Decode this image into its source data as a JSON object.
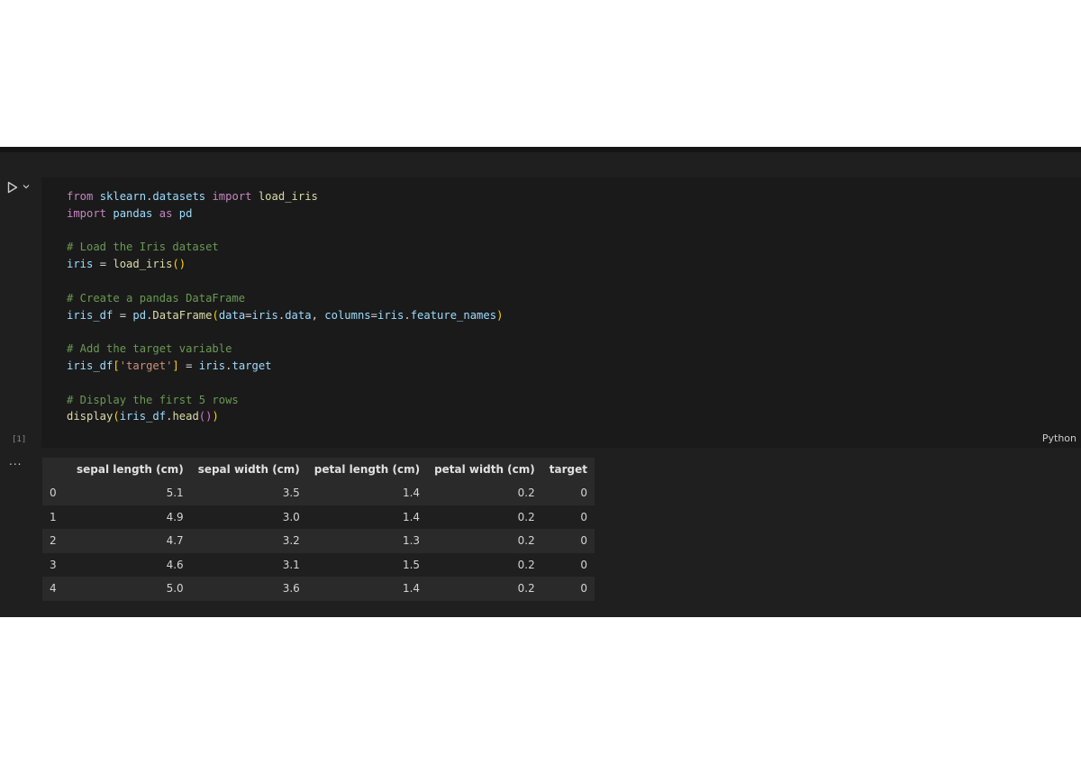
{
  "cell": {
    "execution_count": "[1]",
    "language": "Python",
    "code_lines": [
      [
        [
          "kw",
          "from"
        ],
        [
          "op",
          " "
        ],
        [
          "id",
          "sklearn"
        ],
        [
          "op",
          "."
        ],
        [
          "id",
          "datasets"
        ],
        [
          "op",
          " "
        ],
        [
          "kw",
          "import"
        ],
        [
          "op",
          " "
        ],
        [
          "fn",
          "load_iris"
        ]
      ],
      [
        [
          "kw",
          "import"
        ],
        [
          "op",
          " "
        ],
        [
          "id",
          "pandas"
        ],
        [
          "op",
          " "
        ],
        [
          "kw",
          "as"
        ],
        [
          "op",
          " "
        ],
        [
          "id",
          "pd"
        ]
      ],
      [],
      [
        [
          "cm",
          "# Load the Iris dataset"
        ]
      ],
      [
        [
          "id",
          "iris"
        ],
        [
          "op",
          " = "
        ],
        [
          "fn",
          "load_iris"
        ],
        [
          "pn",
          "()"
        ]
      ],
      [],
      [
        [
          "cm",
          "# Create a pandas DataFrame"
        ]
      ],
      [
        [
          "id",
          "iris_df"
        ],
        [
          "op",
          " = "
        ],
        [
          "id",
          "pd"
        ],
        [
          "op",
          "."
        ],
        [
          "fn",
          "DataFrame"
        ],
        [
          "pn",
          "("
        ],
        [
          "id",
          "data"
        ],
        [
          "op",
          "="
        ],
        [
          "id",
          "iris"
        ],
        [
          "op",
          "."
        ],
        [
          "id",
          "data"
        ],
        [
          "op",
          ", "
        ],
        [
          "id",
          "columns"
        ],
        [
          "op",
          "="
        ],
        [
          "id",
          "iris"
        ],
        [
          "op",
          "."
        ],
        [
          "id",
          "feature_names"
        ],
        [
          "pn",
          ")"
        ]
      ],
      [],
      [
        [
          "cm",
          "# Add the target variable"
        ]
      ],
      [
        [
          "id",
          "iris_df"
        ],
        [
          "pn",
          "["
        ],
        [
          "st",
          "'target'"
        ],
        [
          "pn",
          "]"
        ],
        [
          "op",
          " = "
        ],
        [
          "id",
          "iris"
        ],
        [
          "op",
          "."
        ],
        [
          "id",
          "target"
        ]
      ],
      [],
      [
        [
          "cm",
          "# Display the first 5 rows"
        ]
      ],
      [
        [
          "fn",
          "display"
        ],
        [
          "pn",
          "("
        ],
        [
          "id",
          "iris_df"
        ],
        [
          "op",
          "."
        ],
        [
          "fn",
          "head"
        ],
        [
          "pn2",
          "()"
        ],
        [
          "pn",
          ")"
        ]
      ]
    ]
  },
  "output": {
    "toggle": "...",
    "columns": [
      "",
      "sepal length (cm)",
      "sepal width (cm)",
      "petal length (cm)",
      "petal width (cm)",
      "target"
    ],
    "rows": [
      [
        "0",
        "5.1",
        "3.5",
        "1.4",
        "0.2",
        "0"
      ],
      [
        "1",
        "4.9",
        "3.0",
        "1.4",
        "0.2",
        "0"
      ],
      [
        "2",
        "4.7",
        "3.2",
        "1.3",
        "0.2",
        "0"
      ],
      [
        "3",
        "4.6",
        "3.1",
        "1.5",
        "0.2",
        "0"
      ],
      [
        "4",
        "5.0",
        "3.6",
        "1.4",
        "0.2",
        "0"
      ]
    ]
  }
}
